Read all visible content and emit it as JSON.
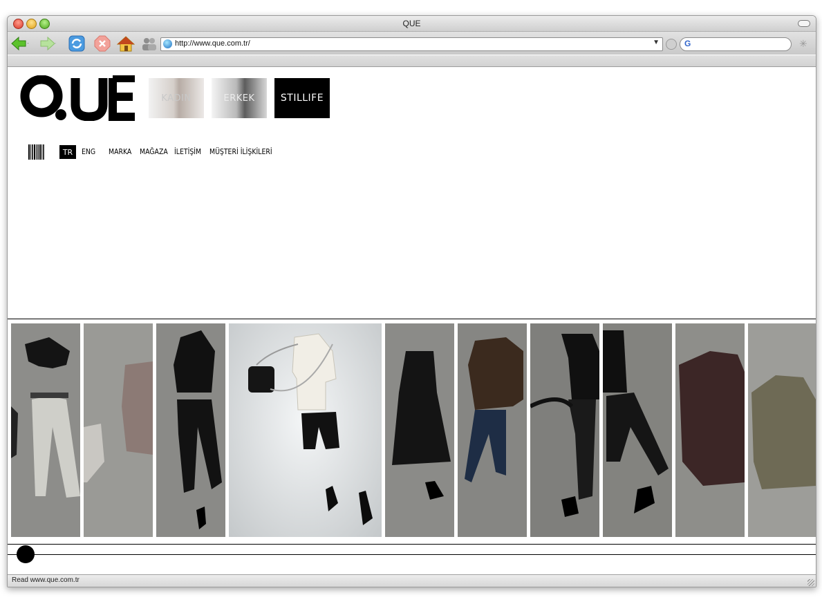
{
  "window": {
    "title": "QUE"
  },
  "toolbar": {
    "url": "http://www.que.com.tr/"
  },
  "page": {
    "logo_text": "QUE",
    "categories": [
      {
        "label": "KADIN"
      },
      {
        "label": "ERKEK"
      },
      {
        "label": "STILLIFE"
      }
    ],
    "nav": {
      "lang_active": "TR",
      "lang_other": "ENG",
      "items": [
        "MARKA",
        "MAĞAZA",
        "İLETİŞİM",
        "MÜŞTERİ İLİŞKİLERİ"
      ]
    }
  },
  "statusbar": {
    "text": "Read www.que.com.tr"
  },
  "colors": {
    "accent": "#000000",
    "panel_bg": "#8a8a86",
    "active_panel_bg": "#d9dbdc"
  },
  "icons": [
    "back-arrow-icon",
    "forward-arrow-icon",
    "reload-icon",
    "stop-icon",
    "home-icon",
    "people-icon",
    "globe-icon",
    "google-icon",
    "barcode-icon"
  ]
}
